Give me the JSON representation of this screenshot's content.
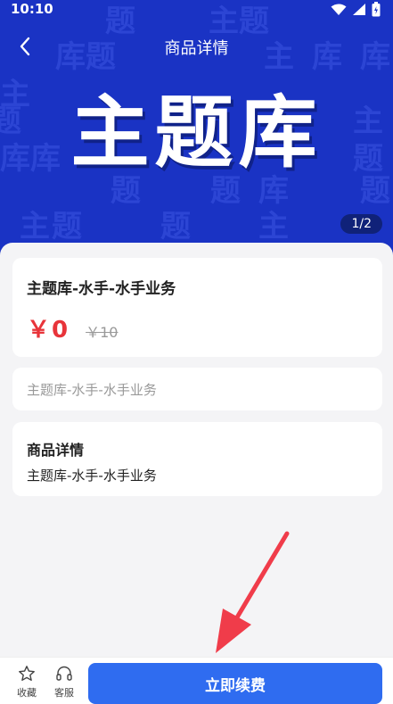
{
  "status_bar": {
    "time": "10:10"
  },
  "nav": {
    "title": "商品详情"
  },
  "banner": {
    "hero_text": "主题库",
    "background_words": [
      "题",
      "主",
      "题",
      "库",
      "题",
      "主",
      "库",
      "主",
      "库",
      "库",
      "题",
      "主",
      "题",
      "库",
      "题",
      "题",
      "题",
      "主",
      "题",
      "主",
      "题",
      "库"
    ],
    "page_indicator": "1/2",
    "background_color": "#1a33c4"
  },
  "product": {
    "name": "主题库-水手-水手业务",
    "price": "￥0",
    "original_price": "￥10",
    "subtitle": "主题库-水手-水手业务",
    "price_color": "#e8343a"
  },
  "detail": {
    "title": "商品详情",
    "text": "主题库-水手-水手业务"
  },
  "bottom_bar": {
    "favorite_label": "收藏",
    "favorite_icon": "star-icon",
    "service_label": "客服",
    "service_icon": "headset-icon",
    "renew_label": "立即续费",
    "accent_color": "#2f6cf0"
  }
}
